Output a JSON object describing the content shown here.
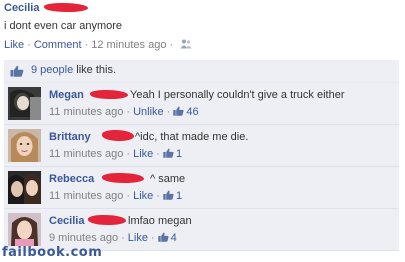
{
  "post": {
    "author": "Cecilia",
    "status": "i dont even car anymore",
    "like_label": "Like",
    "comment_label": "Comment",
    "timestamp": "12 minutes ago",
    "separator": "·"
  },
  "likes": {
    "count_link": "9 people",
    "suffix": " like this."
  },
  "comments": [
    {
      "name": "Megan",
      "text": "Yeah I personally couldn't give a truck either",
      "time": "11 minutes ago",
      "action": "Unlike",
      "likes": "46"
    },
    {
      "name": "Brittany",
      "text": "^idc, that made me die.",
      "time": "11 minutes ago",
      "action": "Like",
      "likes": "1"
    },
    {
      "name": "Rebecca",
      "text": "^ same",
      "time": "11 minutes ago",
      "action": "Like",
      "likes": "1"
    },
    {
      "name": "Cecilia",
      "text": "lmfao megan",
      "time": "9 minutes ago",
      "action": "Like",
      "likes": "4"
    }
  ],
  "footer": {
    "watermark": "failbook.com"
  },
  "colors": {
    "link": "#3b5998",
    "comment_bg": "#edeff4",
    "scribble": "#e3243b"
  }
}
